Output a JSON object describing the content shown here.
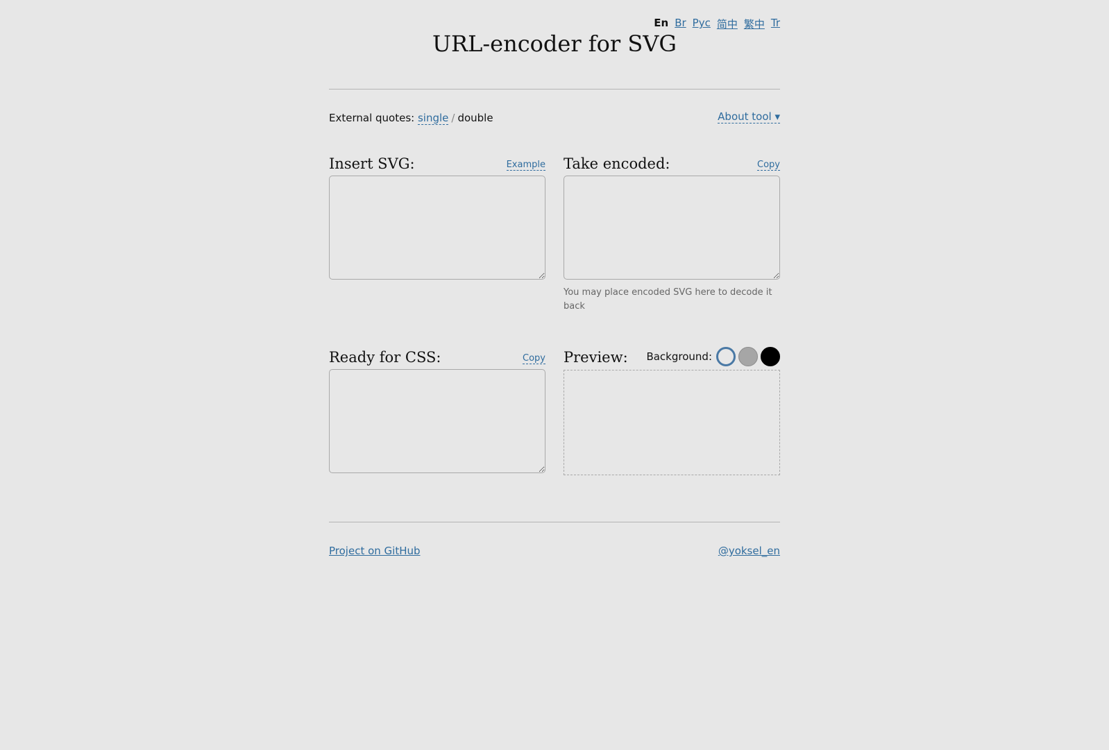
{
  "languages": [
    {
      "label": "En",
      "active": true
    },
    {
      "label": "Br",
      "active": false
    },
    {
      "label": "Рус",
      "active": false
    },
    {
      "label": "简中",
      "active": false
    },
    {
      "label": "繁中",
      "active": false
    },
    {
      "label": "Tr",
      "active": false
    }
  ],
  "title": "URL-encoder for SVG",
  "quotes": {
    "label": "External quotes:",
    "single": "single",
    "separator": "/",
    "double": "double"
  },
  "about": "About tool ▾",
  "insert": {
    "heading": "Insert SVG:",
    "action": "Example",
    "value": ""
  },
  "encoded": {
    "heading": "Take encoded:",
    "action": "Copy",
    "value": "",
    "hint": "You may place encoded SVG here to decode it back"
  },
  "css": {
    "heading": "Ready for CSS:",
    "action": "Copy",
    "value": ""
  },
  "preview": {
    "heading": "Preview:",
    "background_label": "Background:",
    "swatches": [
      "#ffffff",
      "#a6a6a6",
      "#000000"
    ],
    "selected_swatch": "#ffffff"
  },
  "footer": {
    "github": "Project on GitHub",
    "twitter": "@yoksel_en"
  },
  "colors": {
    "background": "#e7e7e7",
    "link": "#2f6c9e",
    "selected_ring": "#4a79a5"
  }
}
